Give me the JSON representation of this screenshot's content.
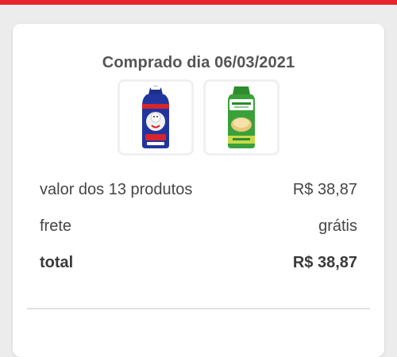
{
  "order": {
    "purchase_date_label": "Comprado dia 06/03/2021",
    "products": [
      {
        "icon": "bread-bag-blue-icon"
      },
      {
        "icon": "bread-bag-green-icon"
      }
    ]
  },
  "summary": {
    "products_label": "valor dos 13 produtos",
    "products_value": "R$ 38,87",
    "shipping_label": "frete",
    "shipping_value": "grátis",
    "total_label": "total",
    "total_value": "R$ 38,87"
  },
  "colors": {
    "accent": "#e8232f",
    "text": "#454545"
  }
}
